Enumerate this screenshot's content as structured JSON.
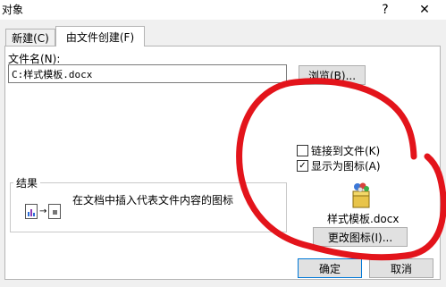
{
  "window": {
    "title": "对象",
    "help_glyph": "?",
    "close_glyph": "✕"
  },
  "tabs": [
    {
      "label": "新建(C)"
    },
    {
      "label": "由文件创建(F)"
    }
  ],
  "file": {
    "label": "文件名(N):",
    "value": "C:样式模板.docx",
    "browse_label": "浏览(B)..."
  },
  "options": {
    "link_label": "链接到文件(K)",
    "link_checked": false,
    "show_icon_label": "显示为图标(A)",
    "show_icon_checked": true
  },
  "result": {
    "title": "结果",
    "text": "在文档中插入代表文件内容的图标"
  },
  "icon_preview": {
    "caption": "样式模板.docx",
    "change_label": "更改图标(I)..."
  },
  "footer": {
    "ok_label": "确定",
    "cancel_label": "取消"
  },
  "colors": {
    "annotation_red": "#e3141b",
    "button_face": "#e1e1e1",
    "focus_border": "#0078d7"
  }
}
